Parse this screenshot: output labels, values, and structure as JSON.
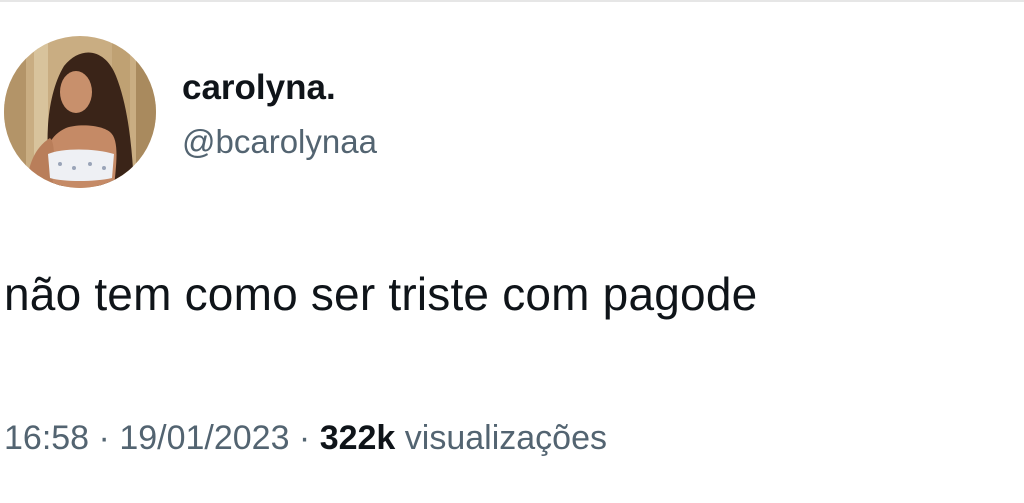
{
  "author": {
    "display_name": "carolyna.",
    "handle": "@bcarolynaa",
    "avatar_icon": "profile-photo-avatar"
  },
  "tweet": {
    "text": "não tem como ser triste com pagode"
  },
  "meta": {
    "time": "16:58",
    "separator": " · ",
    "date": "19/01/2023",
    "views_count": "322k",
    "views_label": " visualizações"
  },
  "colors": {
    "text_primary": "#0f1419",
    "text_secondary": "#536471",
    "background": "#ffffff"
  }
}
